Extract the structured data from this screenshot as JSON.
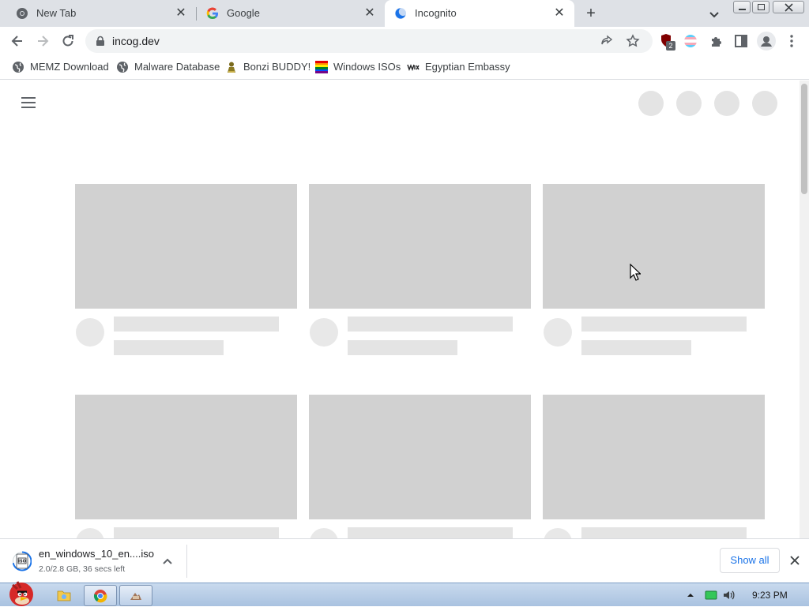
{
  "browser": {
    "tabs": [
      {
        "title": "New Tab",
        "favicon": "chrome-icon",
        "active": false
      },
      {
        "title": "Google",
        "favicon": "google-icon",
        "active": false
      },
      {
        "title": "Incognito",
        "favicon": "incognito-icon",
        "active": true
      }
    ],
    "new_tab_symbol": "+",
    "close_symbol": "✕",
    "address": "incog.dev",
    "extension_badge": "2",
    "bookmarks": [
      {
        "label": "MEMZ Download",
        "icon": "globe-icon"
      },
      {
        "label": "Malware Database",
        "icon": "globe-icon"
      },
      {
        "label": "Bonzi BUDDY!",
        "icon": "bonzi-icon"
      },
      {
        "label": "Windows ISOs",
        "icon": "windows-flag-icon"
      },
      {
        "label": "Egyptian Embassy",
        "icon": "wix-icon"
      }
    ]
  },
  "download": {
    "filename": "en_windows_10_en....iso",
    "status": "2.0/2.8 GB, 36 secs left",
    "progress": 0.714,
    "show_all_label": "Show all",
    "icon_text": "ISO"
  },
  "taskbar": {
    "clock": "9:23 PM"
  },
  "colors": {
    "tabstrip": "#dee1e6",
    "accent_link": "#1a73e8",
    "skeleton_thumb": "#d1d1d1",
    "skeleton_line": "#e4e4e4"
  }
}
